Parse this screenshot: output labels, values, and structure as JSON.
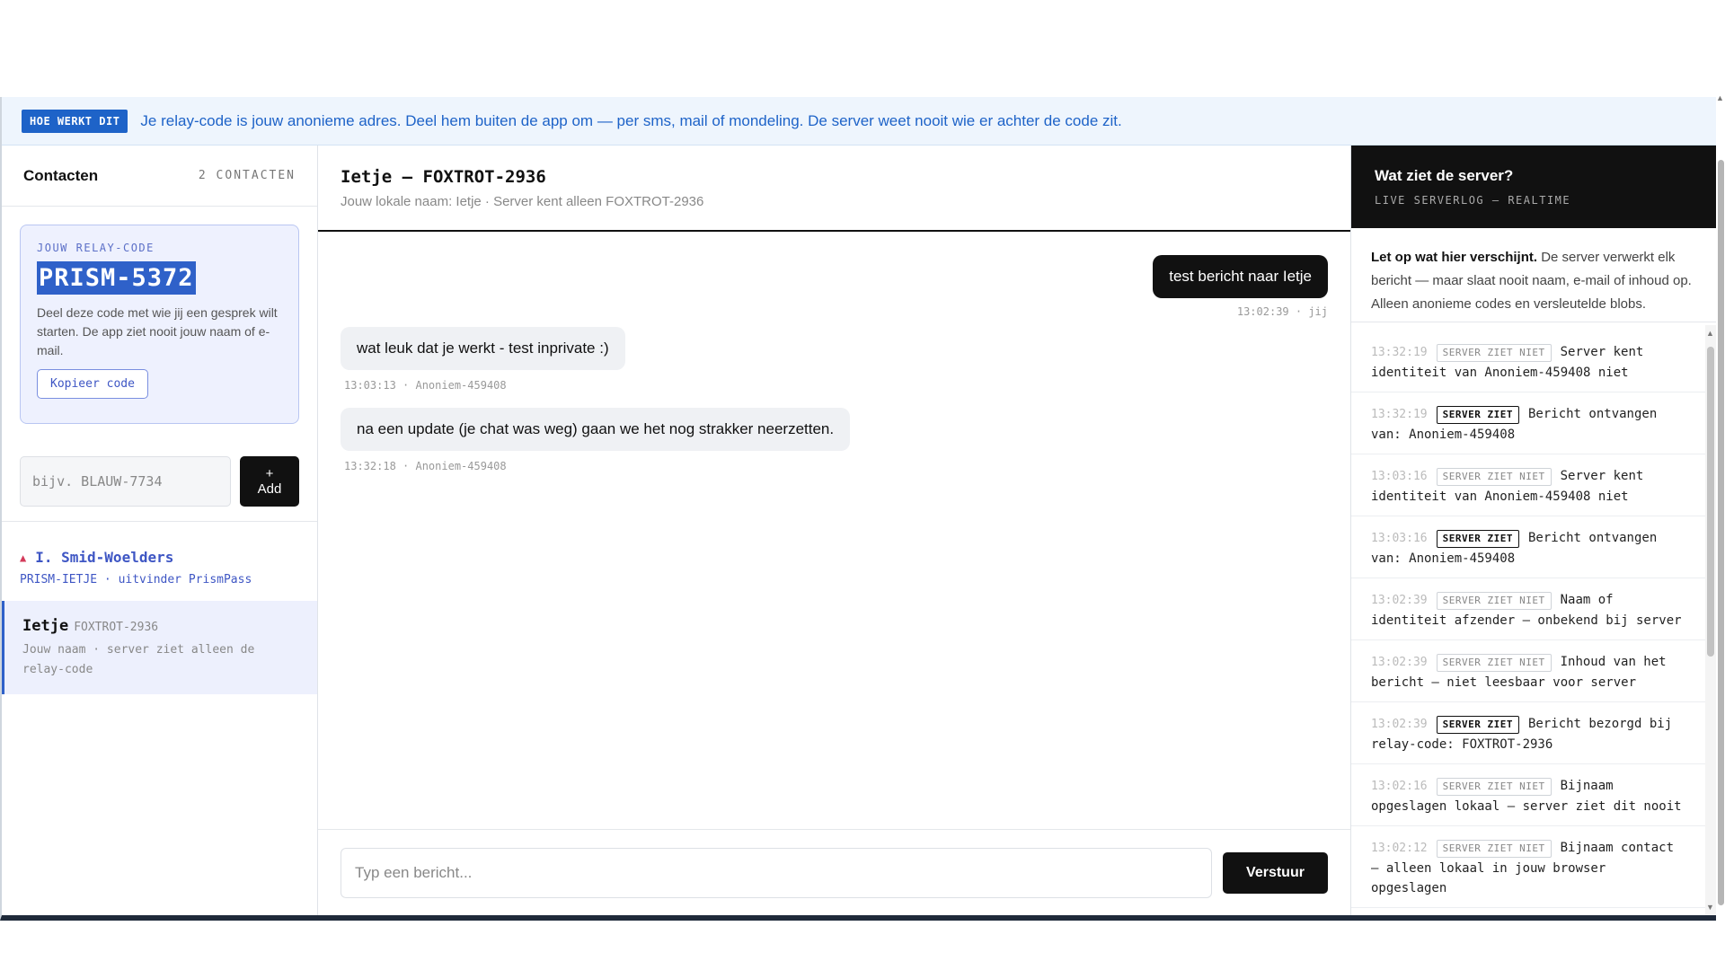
{
  "banner": {
    "badge": "HOE WERKT DIT",
    "text": "Je relay-code is jouw anonieme adres. Deel hem buiten de app om — per sms, mail of mondeling. De server weet nooit wie er achter de code zit."
  },
  "contacts": {
    "title": "Contacten",
    "count": "2 CONTACTEN",
    "relay": {
      "label": "JOUW RELAY-CODE",
      "code": "PRISM-5372",
      "description": "Deel deze code met wie jij een gesprek wilt starten. De app ziet nooit jouw naam of e-mail.",
      "copy_label": "Kopieer code"
    },
    "add": {
      "placeholder": "bijv. BLAUW-7734",
      "button_plus": "+",
      "button_label": "Add"
    },
    "items": [
      {
        "name": "I. Smid-Woelders",
        "detail": "PRISM-IETJE · uitvinder PrismPass"
      },
      {
        "name": "Ietje",
        "code": "FOXTROT-2936",
        "detail": "Jouw naam · server ziet alleen de relay-code"
      }
    ]
  },
  "chat": {
    "title": "Ietje — FOXTROT-2936",
    "subtitle": "Jouw lokale naam: Ietje · Server kent alleen FOXTROT-2936",
    "messages": [
      {
        "text": "test bericht naar Ietje",
        "meta": "13:02:39 · jij"
      },
      {
        "text": "wat leuk dat je werkt - test inprivate :)",
        "meta": "13:03:13 · Anoniem-459408"
      },
      {
        "text": "na een update (je chat was weg) gaan we het nog strakker neerzetten.",
        "meta": "13:32:18 · Anoniem-459408"
      }
    ],
    "composer_placeholder": "Typ een bericht...",
    "send_label": "Verstuur"
  },
  "server": {
    "title": "Wat ziet de server?",
    "subtitle": "LIVE SERVERLOG — REALTIME",
    "intro_bold": "Let op wat hier verschijnt.",
    "intro_rest": " De server verwerkt elk bericht — maar slaat nooit naam, e-mail of inhoud op. Alleen anonieme codes en versleutelde blobs.",
    "log": [
      {
        "ts": "13:32:19",
        "tag": "SERVER ZIET NIET",
        "text": "Server kent identiteit van Anoniem-459408 niet"
      },
      {
        "ts": "13:32:19",
        "tag": "SERVER ZIET",
        "text": "Bericht ontvangen van: Anoniem-459408"
      },
      {
        "ts": "13:03:16",
        "tag": "SERVER ZIET NIET",
        "text": "Server kent identiteit van Anoniem-459408 niet"
      },
      {
        "ts": "13:03:16",
        "tag": "SERVER ZIET",
        "text": "Bericht ontvangen van: Anoniem-459408"
      },
      {
        "ts": "13:02:39",
        "tag": "SERVER ZIET NIET",
        "text": "Naam of identiteit afzender — onbekend bij server"
      },
      {
        "ts": "13:02:39",
        "tag": "SERVER ZIET NIET",
        "text": "Inhoud van het bericht — niet leesbaar voor server"
      },
      {
        "ts": "13:02:39",
        "tag": "SERVER ZIET",
        "text": "Bericht bezorgd bij relay-code: FOXTROT-2936"
      },
      {
        "ts": "13:02:16",
        "tag": "SERVER ZIET NIET",
        "text": "Bijnaam opgeslagen lokaal — server ziet dit nooit"
      },
      {
        "ts": "13:02:12",
        "tag": "SERVER ZIET NIET",
        "text": "Bijnaam contact — alleen lokaal in jouw browser opgeslagen"
      }
    ]
  }
}
